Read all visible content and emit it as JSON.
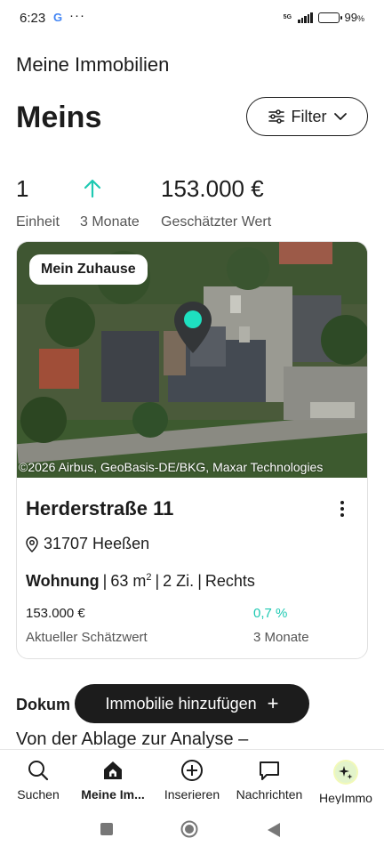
{
  "status_bar": {
    "time": "6:23",
    "google_glyph": "G",
    "more": "···",
    "network": "5G",
    "battery": "99",
    "battery_unit": "%"
  },
  "header": {
    "page_title": "Meine Immobilien",
    "section_title": "Meins",
    "filter_label": "Filter"
  },
  "stats": [
    {
      "value": "1",
      "label": "Einheit"
    },
    {
      "value": "",
      "label": "3 Monate",
      "icon": "arrow-up-icon"
    },
    {
      "value": "153.000 €",
      "label": "Geschätzter Wert"
    }
  ],
  "card": {
    "badge": "Mein Zuhause",
    "map_credit": "©2026 Airbus, GeoBasis-DE/BKG, Maxar Technologies",
    "street": "Herderstraße 11",
    "location": "31707 Heeßen",
    "type": "Wohnung",
    "area": "63 m",
    "area_sup": "2",
    "rooms": "2 Zi.",
    "side": "Rechts",
    "price": "153.000 €",
    "price_label": "Aktueller Schätzwert",
    "change": "0,7 %",
    "change_label": "3 Monate"
  },
  "docs": {
    "title": "Dokum",
    "subtitle": "Von der Ablage zur Analyse –"
  },
  "fab": {
    "label": "Immobilie hinzufügen",
    "plus": "+"
  },
  "nav": [
    {
      "label": "Suchen",
      "icon": "search-icon"
    },
    {
      "label": "Meine Im...",
      "icon": "home-icon",
      "active": true
    },
    {
      "label": "Inserieren",
      "icon": "plus-circle-icon"
    },
    {
      "label": "Nachrichten",
      "icon": "chat-icon"
    },
    {
      "label": "HeyImmo",
      "icon": "sparkle-icon"
    }
  ],
  "colors": {
    "accent": "#1ec9b2",
    "text": "#1c1c1c",
    "muted": "#555555"
  }
}
